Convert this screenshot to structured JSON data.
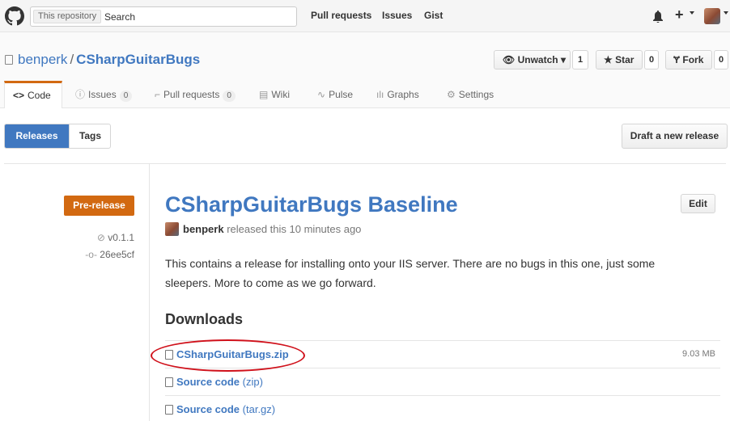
{
  "header": {
    "search_scope": "This repository",
    "search_placeholder": "Search",
    "nav": [
      "Pull requests",
      "Issues",
      "Gist"
    ]
  },
  "repo": {
    "owner": "benperk",
    "separator": "/",
    "name": "CSharpGuitarBugs",
    "unwatch_label": "Unwatch",
    "unwatch_count": "1",
    "star_label": "Star",
    "star_count": "0",
    "fork_label": "Fork",
    "fork_count": "0"
  },
  "tabs": {
    "code": "Code",
    "issues": "Issues",
    "issues_count": "0",
    "pull_requests": "Pull requests",
    "pull_requests_count": "0",
    "wiki": "Wiki",
    "pulse": "Pulse",
    "graphs": "Graphs",
    "settings": "Settings"
  },
  "subnav": {
    "releases": "Releases",
    "tags": "Tags",
    "draft_button": "Draft a new release"
  },
  "release": {
    "badge": "Pre-release",
    "tag": "v0.1.1",
    "commit": "26ee5cf",
    "title": "CSharpGuitarBugs Baseline",
    "edit_button": "Edit",
    "author": "benperk",
    "released_text": "released this 10 minutes ago",
    "description": "This contains a release for installing onto your IIS server. There are no bugs in this one, just some sleepers. More to come as we go forward.",
    "downloads_heading": "Downloads",
    "downloads": [
      {
        "name": "CSharpGuitarBugs.zip",
        "ext": "",
        "size": "9.03 MB"
      },
      {
        "name": "Source code",
        "ext": "(zip)",
        "size": ""
      },
      {
        "name": "Source code",
        "ext": "(tar.gz)",
        "size": ""
      }
    ]
  },
  "colors": {
    "link": "#4078c0",
    "accent": "#d26911",
    "annotation": "#d0111b"
  }
}
